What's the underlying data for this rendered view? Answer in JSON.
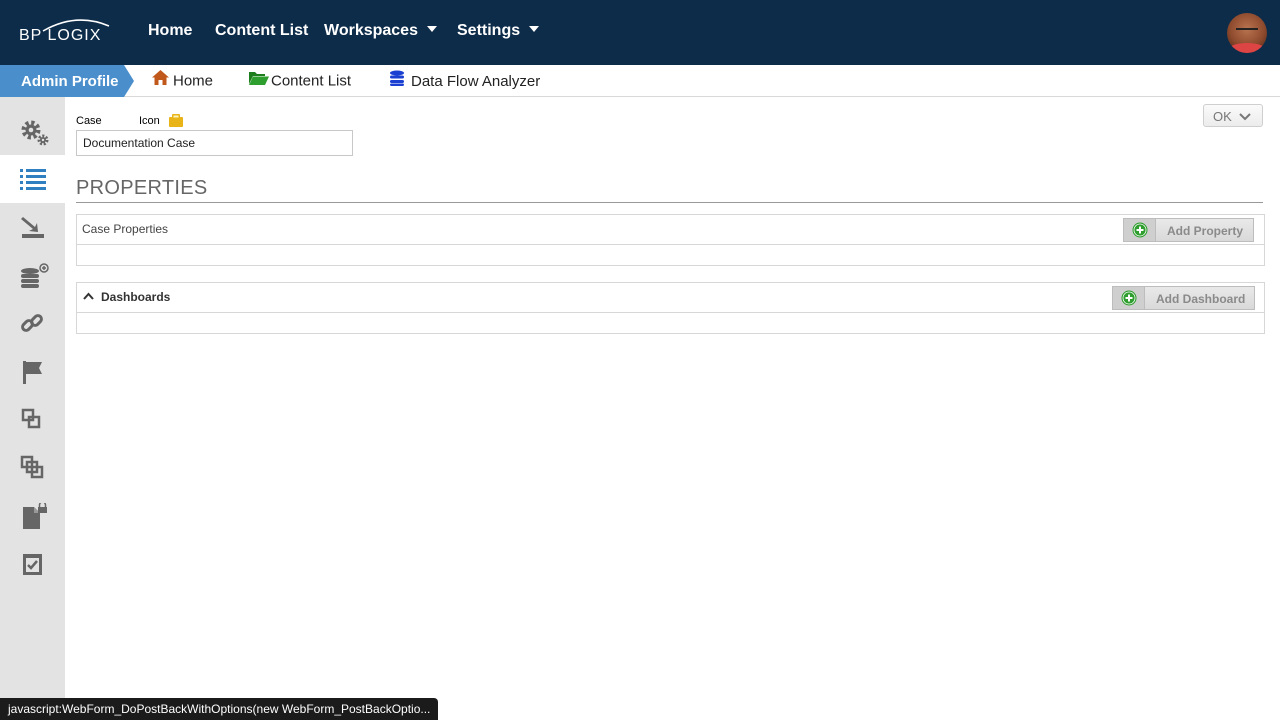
{
  "brand": {
    "logo_text": "BP LOGIX"
  },
  "topnav": {
    "home": "Home",
    "content_list": "Content List",
    "workspaces": "Workspaces",
    "settings": "Settings"
  },
  "breadcrumb": {
    "admin_profile": "Admin Profile",
    "home": "Home",
    "content_list": "Content List",
    "data_flow_analyzer": "Data Flow Analyzer"
  },
  "sidebar": {
    "items": [
      "settings-gears-icon",
      "list-icon",
      "import-icon",
      "database-add-icon",
      "link-icon",
      "flag-icon",
      "copy-icon",
      "layers-icon",
      "locked-document-icon",
      "checkbox-icon"
    ],
    "active_index": 1
  },
  "form": {
    "case_label": "Case",
    "icon_label": "Icon",
    "case_value": "Documentation Case",
    "ok_label": "OK"
  },
  "properties": {
    "section_title": "PROPERTIES",
    "case_properties_title": "Case Properties",
    "add_property_label": "Add Property",
    "dashboards_title": "Dashboards",
    "add_dashboard_label": "Add Dashboard"
  },
  "statusbar": {
    "text": "javascript:WebForm_DoPostBackWithOptions(new WebForm_PostBackOptio..."
  },
  "colors": {
    "topbar_bg": "#0d2c4a",
    "admin_tab": "#4a8fcc",
    "sidebar_bg": "#e3e3e3",
    "add_icon_green": "#2e9e2e",
    "folder_yellow": "#e8b418"
  }
}
